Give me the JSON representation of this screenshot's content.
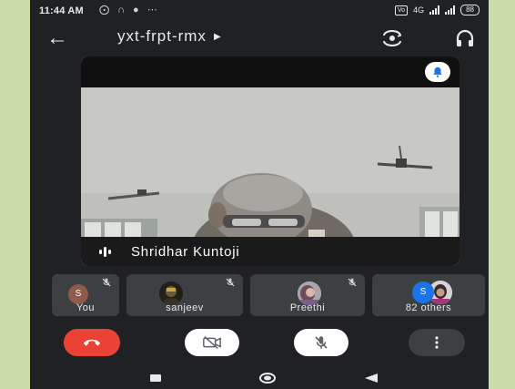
{
  "status_bar": {
    "time": "11:44 AM",
    "network": "4G",
    "battery": "88",
    "notification_icons": [
      "voicemail-icon",
      "headset-icon",
      "location-icon",
      "more-dots-icon"
    ]
  },
  "header": {
    "title": "yxt-frpt-rmx",
    "icons": [
      "back-arrow-icon",
      "caret-right-icon",
      "switch-camera-icon",
      "headphones-icon"
    ]
  },
  "main_video": {
    "participant_name": "Shridhar Kuntoji",
    "icons": [
      "bell-icon",
      "speaking-indicator-icon"
    ]
  },
  "participants": [
    {
      "label": "You",
      "avatar_letter": "S",
      "avatar_color": "#8d5a4c",
      "muted": true
    },
    {
      "label": "sanjeev",
      "muted": true
    },
    {
      "label": "Preethi",
      "muted": true
    },
    {
      "label": "82 others",
      "avatar_letter": "S",
      "avatar_color": "#1a73e8",
      "muted": false
    }
  ],
  "controls": {
    "colors": {
      "end_call": "#ea4335",
      "control_bg": "#ffffff",
      "more_bg": "#3c4043"
    },
    "icons": [
      "hang-up-icon",
      "camera-off-icon",
      "mic-off-icon",
      "more-vertical-icon"
    ]
  },
  "nav_bar": {
    "icons": [
      "recent-apps-icon",
      "home-icon",
      "back-triangle-icon"
    ]
  }
}
